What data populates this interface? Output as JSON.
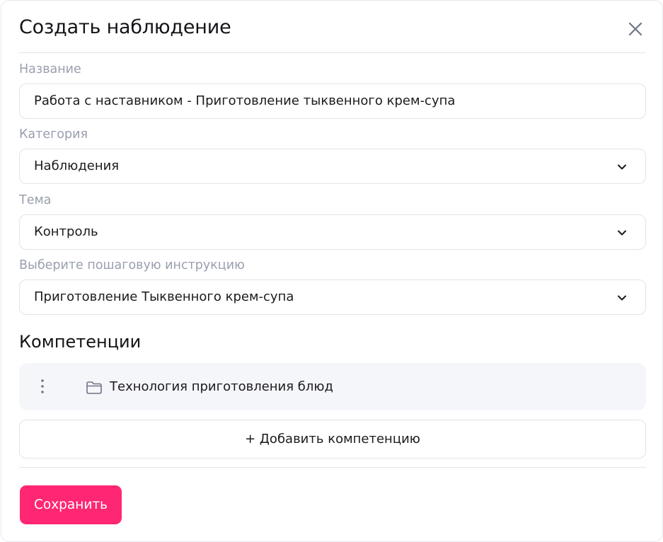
{
  "dialog": {
    "title": "Создать наблюдение",
    "close_icon": "close-icon"
  },
  "form": {
    "name": {
      "label": "Название",
      "value": "Работа с наставником - Приготовление тыквенного крем-супа"
    },
    "category": {
      "label": "Категория",
      "value": "Наблюдения"
    },
    "theme": {
      "label": "Тема",
      "value": "Контроль"
    },
    "instruction": {
      "label": "Выберите пошаговую инструкцию",
      "value": "Приготовление Тыквенного крем-супа"
    }
  },
  "competencies": {
    "title": "Компетенции",
    "items": [
      {
        "label": "Технология приготовления блюд",
        "icon": "folder-icon"
      }
    ],
    "add_label": "+ Добавить компетенцию"
  },
  "footer": {
    "save_label": "Сохранить"
  },
  "colors": {
    "accent": "#ff2673",
    "label_gray": "#9a9fae",
    "row_bg": "#f5f6fa"
  }
}
